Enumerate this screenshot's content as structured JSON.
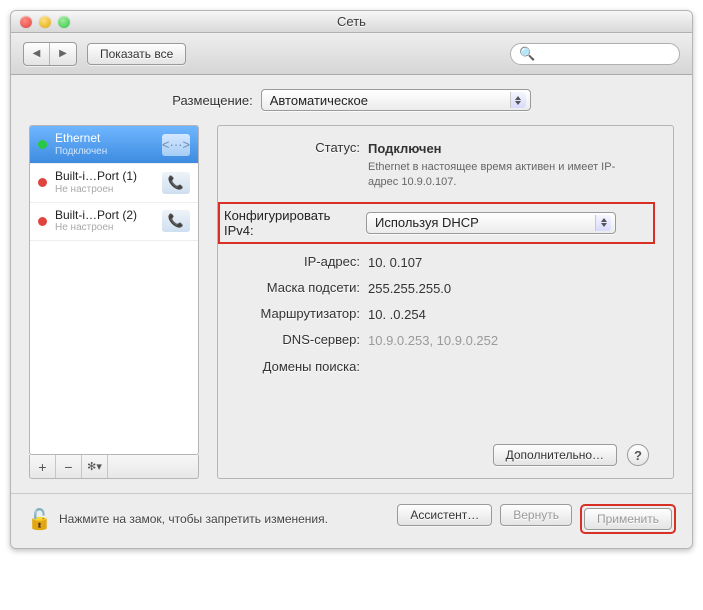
{
  "window": {
    "title": "Сеть"
  },
  "toolbar": {
    "show_all": "Показать все",
    "search_placeholder": ""
  },
  "location": {
    "label": "Размещение:",
    "value": "Автоматическое"
  },
  "sidebar": {
    "items": [
      {
        "name": "Ethernet",
        "sub": "Подключен",
        "status": "green",
        "icon": "<···>"
      },
      {
        "name": "Built-i…Port (1)",
        "sub": "Не настроен",
        "status": "red",
        "icon": "📞"
      },
      {
        "name": "Built-i…Port (2)",
        "sub": "Не настроен",
        "status": "red",
        "icon": "📞"
      }
    ],
    "footer": {
      "add": "+",
      "remove": "−",
      "gear": "✻▾"
    }
  },
  "status": {
    "label": "Статус:",
    "value": "Подключен",
    "sub": "Ethernet в настоящее время активен и имеет IP-адрес 10.9.0.107."
  },
  "config": {
    "label_l1": "Конфигурировать",
    "label_l2": "IPv4:",
    "value": "Используя DHCP"
  },
  "fields": {
    "ip": {
      "label": "IP-адрес:",
      "value": "10.  0.107"
    },
    "mask": {
      "label": "Маска подсети:",
      "value": "255.255.255.0"
    },
    "router": {
      "label": "Маршрутизатор:",
      "value": "10.  .0.254"
    },
    "dns": {
      "label": "DNS-сервер:",
      "value": "10.9.0.253, 10.9.0.252"
    },
    "search": {
      "label": "Домены поиска:",
      "value": ""
    }
  },
  "advanced": {
    "label": "Дополнительно…"
  },
  "footer": {
    "lock_text": "Нажмите на замок, чтобы запретить изменения.",
    "assistant": "Ассистент…",
    "revert": "Вернуть",
    "apply": "Применить"
  }
}
